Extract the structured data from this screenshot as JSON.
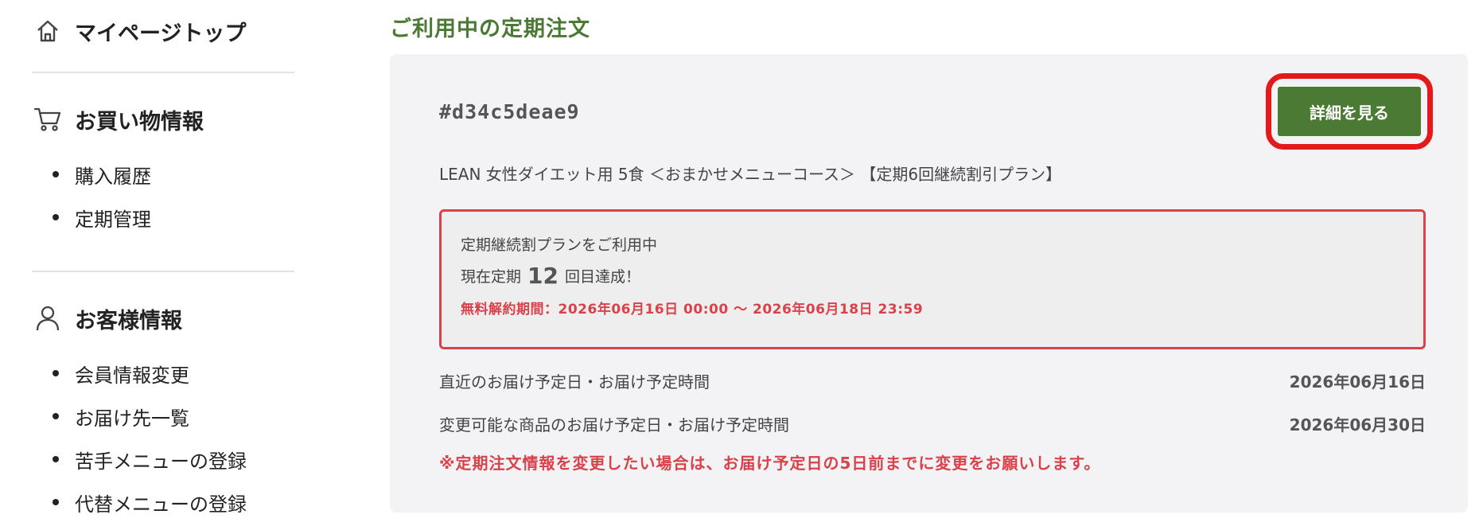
{
  "sidebar": {
    "top": {
      "label": "マイページトップ",
      "icon": "home-icon"
    },
    "shopping": {
      "label": "お買い物情報",
      "icon": "cart-icon",
      "items": [
        {
          "label": "購入履歴"
        },
        {
          "label": "定期管理"
        }
      ]
    },
    "member": {
      "label": "お客様情報",
      "icon": "user-icon",
      "items": [
        {
          "label": "会員情報変更"
        },
        {
          "label": "お届け先一覧"
        },
        {
          "label": "苦手メニューの登録"
        },
        {
          "label": "代替メニューの登録"
        }
      ]
    }
  },
  "main": {
    "title": "ご利用中の定期注文",
    "order": {
      "id": "#d34c5deae9",
      "detail_button": "詳細を見る",
      "product_name": "LEAN 女性ダイエット用 5食 ＜おまかせメニューコース＞ 【定期6回継続割引プラン】",
      "plan": {
        "status": "定期継続割プランをご利用中",
        "count_prefix": "現在定期",
        "count": "12",
        "count_suffix": "回目達成！",
        "cancel_period": "無料解約期間：2026年06月16日 00:00 〜 2026年06月18日 23:59"
      },
      "rows": [
        {
          "label": "直近のお届け予定日・お届け予定時間",
          "value": "2026年06月16日"
        },
        {
          "label": "変更可能な商品のお届け予定日・お届け予定時間",
          "value": "2026年06月30日"
        }
      ],
      "notice": "※定期注文情報を変更したい場合は、お届け予定日の5日前までに変更をお願いします。"
    }
  },
  "colors": {
    "accent_green": "#4a7a33",
    "alert_red": "#d9424a",
    "highlight_red": "#e5191a",
    "card_bg": "#f3f3f5"
  }
}
